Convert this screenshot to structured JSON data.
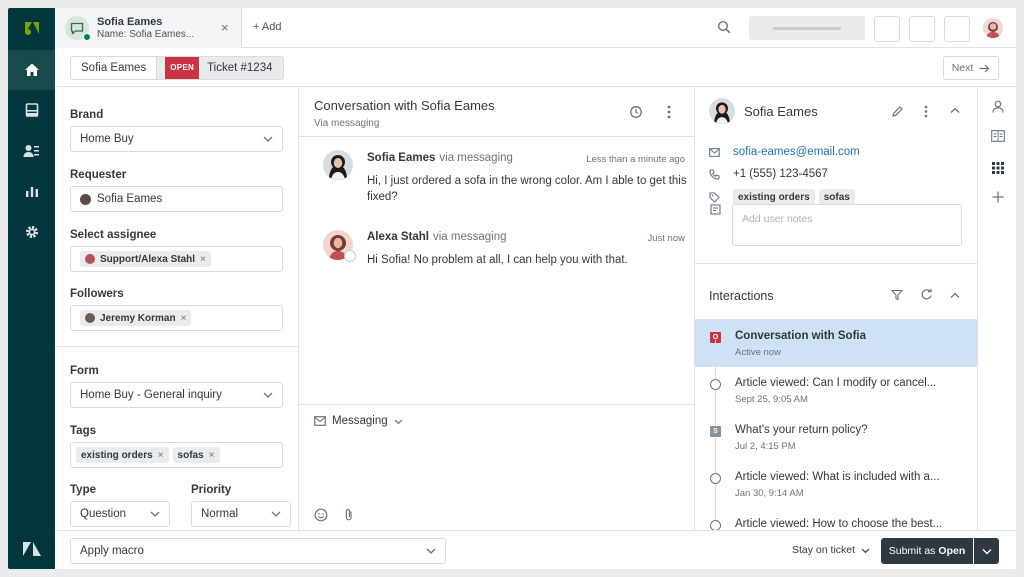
{
  "tab": {
    "title": "Sofia Eames",
    "subtitle": "Name: Sofia Eames...",
    "close": "×",
    "add": "+ Add"
  },
  "subbar": {
    "requester": "Sofia Eames",
    "status": "OPEN",
    "ticket": "Ticket #1234",
    "next": "Next"
  },
  "form": {
    "brand_label": "Brand",
    "brand_value": "Home Buy",
    "requester_label": "Requester",
    "requester_value": "Sofia Eames",
    "assignee_label": "Select assignee",
    "assignee_value": "Support/Alexa Stahl",
    "followers_label": "Followers",
    "followers_value": "Jeremy Korman",
    "form_label": "Form",
    "form_value": "Home Buy - General inquiry",
    "tags_label": "Tags",
    "tags": [
      "existing orders",
      "sofas"
    ],
    "type_label": "Type",
    "type_value": "Question",
    "priority_label": "Priority",
    "priority_value": "Normal",
    "remove": "×"
  },
  "conversation": {
    "title": "Conversation with Sofia Eames",
    "subtitle": "Via messaging",
    "messages": [
      {
        "author": "Sofia Eames",
        "via": "via messaging",
        "time": "Less than a minute ago",
        "line1": "Hi, I just ordered a sofa in the wrong color. Am I able to get this",
        "line2": "fixed?"
      },
      {
        "author": "Alexa Stahl",
        "via": "via messaging",
        "time": "Just now",
        "line1": "Hi Sofia! No problem at all, I can help you with that."
      }
    ],
    "composer_channel": "Messaging"
  },
  "customer": {
    "name": "Sofia Eames",
    "email": "sofia-eames@email.com",
    "phone": "+1 (555) 123-4567",
    "tags": [
      "existing orders",
      "sofas"
    ],
    "notes_placeholder": "Add user notes"
  },
  "interactions": {
    "title": "Interactions",
    "items": [
      {
        "title": "Conversation with Sofia",
        "sub": "Active now",
        "marker": "O"
      },
      {
        "title": "Article viewed: Can I modify or cancel...",
        "sub": "Sept 25, 9:05 AM",
        "marker": ""
      },
      {
        "title": "What's your return policy?",
        "sub": "Jul 2, 4:15 PM",
        "marker": "S"
      },
      {
        "title": "Article viewed: What is included with a...",
        "sub": "Jan 30, 9:14 AM",
        "marker": ""
      },
      {
        "title": "Article viewed: How to choose the best...",
        "sub": "",
        "marker": ""
      }
    ]
  },
  "footer": {
    "macro": "Apply macro",
    "stay": "Stay on ticket",
    "submit_prefix": "Submit as",
    "submit_status": "Open"
  },
  "colors": {
    "rail": "#03363d",
    "open_badge": "#cc3340",
    "active_interaction": "#cfe1f4",
    "submit": "#2f3941"
  }
}
